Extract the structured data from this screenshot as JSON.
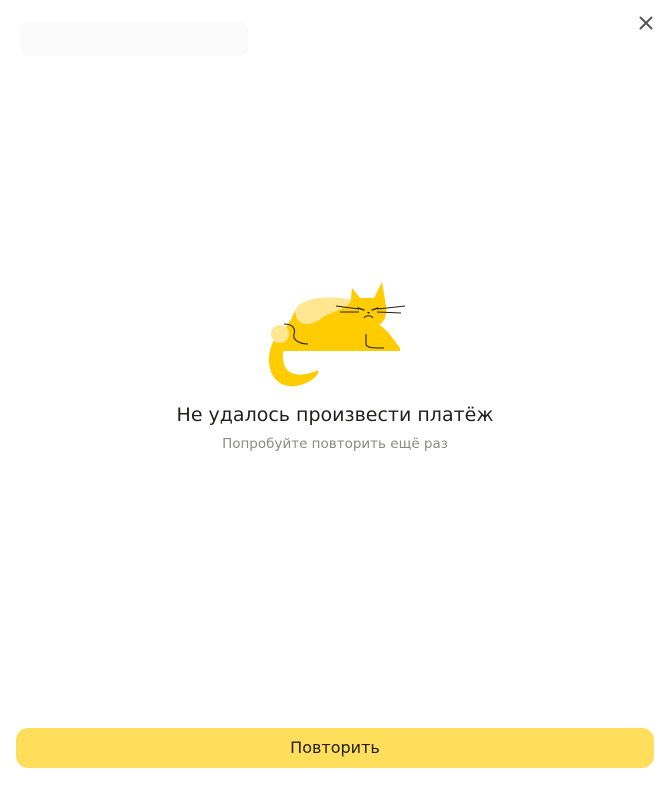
{
  "dialog": {
    "title": "Не удалось произвести платёж",
    "subtitle": "Попробуйте повторить ещё раз",
    "retry_label": "Повторить",
    "close_icon": "close-icon",
    "illustration": "sad-cat-illustration"
  },
  "colors": {
    "accent_yellow": "#FFDE5C",
    "cat_yellow": "#FFCC00",
    "cat_light_yellow": "#FFE792",
    "title_text": "#21201F",
    "subtitle_text": "#8B8A88",
    "close_icon": "#555555"
  }
}
